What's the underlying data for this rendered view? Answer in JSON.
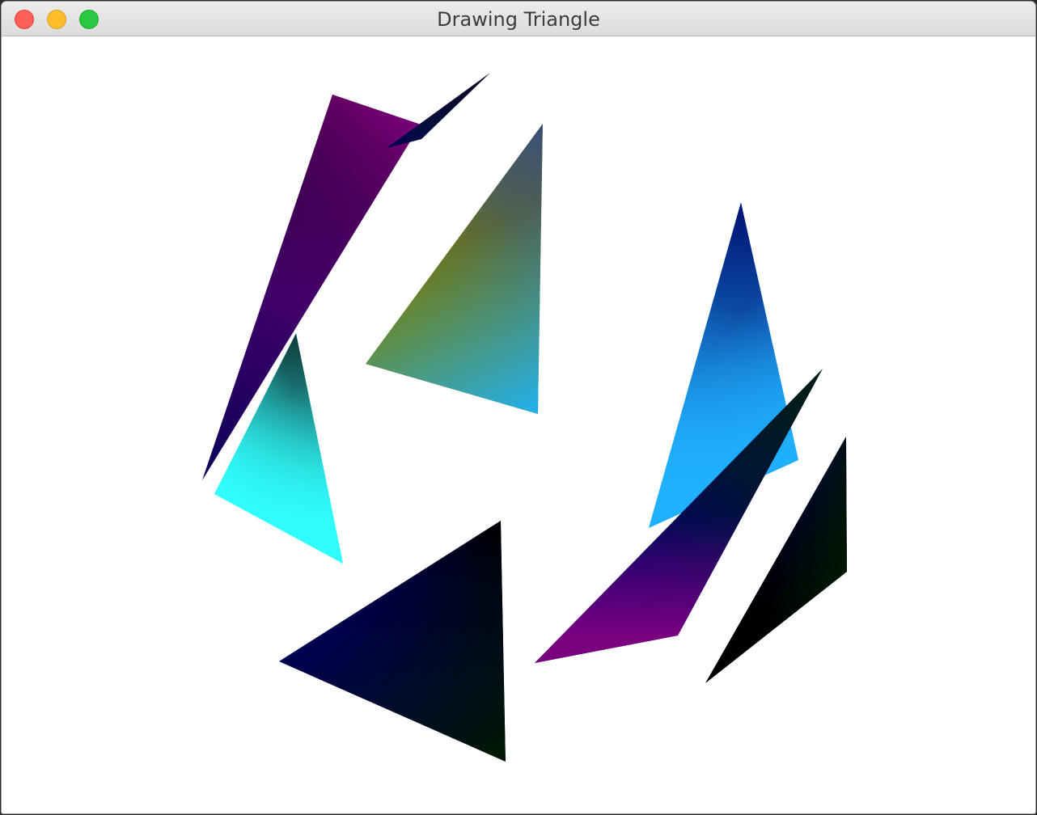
{
  "window": {
    "title": "Drawing Triangle",
    "buttons": {
      "close_color": "#ff5f57",
      "minimize_color": "#ffbd2e",
      "zoom_color": "#28c940"
    }
  },
  "canvas": {
    "background": "#ffffff",
    "triangles": [
      {
        "name": "triangle-purple-tall",
        "colors": [
          "#000000",
          "#7a007a",
          "#0a0058"
        ]
      },
      {
        "name": "triangle-dark-sliver",
        "colors": [
          "#05002a",
          "#0a1a30",
          "#000050"
        ]
      },
      {
        "name": "triangle-olive-blue",
        "colors": [
          "#3a5078",
          "#7a8000",
          "#20b0f0"
        ]
      },
      {
        "name": "triangle-cyan",
        "colors": [
          "#103838",
          "#30ffff",
          "#30ffff"
        ]
      },
      {
        "name": "triangle-blue-tall",
        "colors": [
          "#001070",
          "#20b0ff",
          "#20b0ff"
        ]
      },
      {
        "name": "triangle-navy-black",
        "colors": [
          "#000000",
          "#000050",
          "#001800"
        ]
      },
      {
        "name": "triangle-magenta-diagonal",
        "colors": [
          "#002010",
          "#000070",
          "#7a0080"
        ]
      },
      {
        "name": "triangle-dark-right",
        "colors": [
          "#000050",
          "#000000",
          "#001800"
        ]
      }
    ]
  }
}
